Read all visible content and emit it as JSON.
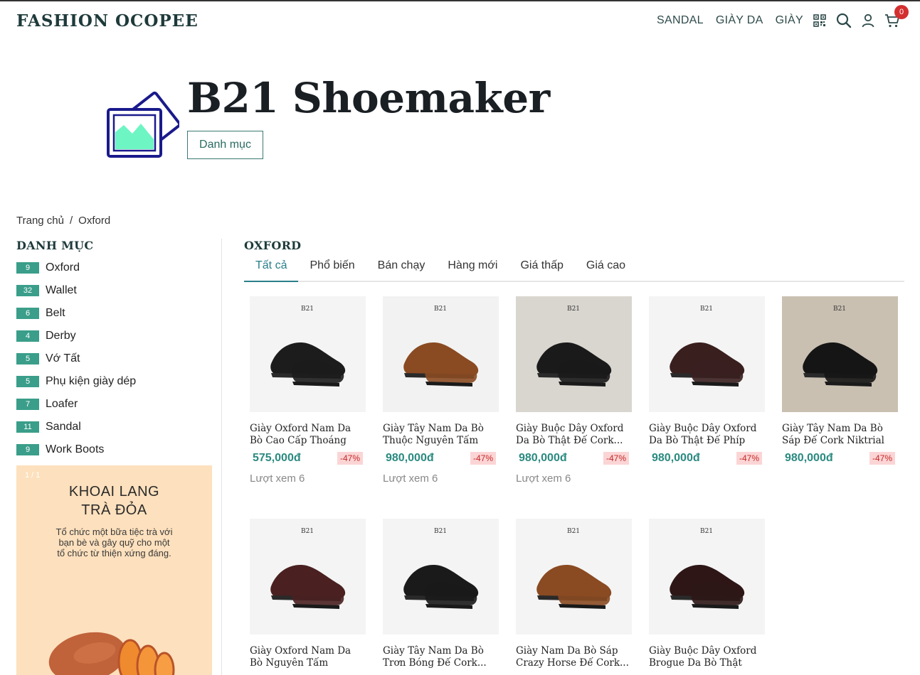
{
  "header": {
    "brand": "FASHION OCOPEE",
    "nav": [
      "SANDAL",
      "GIÀY DA",
      "GIÀY"
    ],
    "cart_count": "0"
  },
  "hero": {
    "title": "B21 Shoemaker",
    "button": "Danh mục"
  },
  "breadcrumb": {
    "home": "Trang chủ",
    "separator": "/",
    "current": "Oxford"
  },
  "sidebar": {
    "title": "DANH MỤC",
    "categories": [
      {
        "count": "9",
        "label": "Oxford"
      },
      {
        "count": "32",
        "label": "Wallet"
      },
      {
        "count": "6",
        "label": "Belt"
      },
      {
        "count": "4",
        "label": "Derby"
      },
      {
        "count": "5",
        "label": "Vớ Tất"
      },
      {
        "count": "5",
        "label": "Phụ kiện giày dép"
      },
      {
        "count": "7",
        "label": "Loafer"
      },
      {
        "count": "11",
        "label": "Sandal"
      },
      {
        "count": "9",
        "label": "Work Boots"
      }
    ],
    "promo": {
      "counter": "1 / 1",
      "title_line1": "KHOAI LANG",
      "title_line2": "TRÀ ĐỎA",
      "desc_line1": "Tổ chức một bữa tiệc trà với",
      "desc_line2": "bạn bè và gây quỹ cho một",
      "desc_line3": "tổ chức từ thiện xứng đáng."
    }
  },
  "main": {
    "title": "OXFORD",
    "tabs": [
      "Tất cả",
      "Phổ biến",
      "Bán chạy",
      "Hàng mới",
      "Giá thấp",
      "Giá cao"
    ],
    "products": [
      {
        "name": "Giày Oxford Nam Da Bò Cao Cấp Thoáng Khí...",
        "price": "575,000đ",
        "discount": "-47%",
        "views": "Lượt xem 6",
        "shoe_color": "#1c1c1c",
        "bg": "#f4f4f4"
      },
      {
        "name": "Giày Tây Nam Da Bò Thuộc Nguyên Tấm Đế...",
        "price": "980,000đ",
        "discount": "-47%",
        "views": "Lượt xem 6",
        "shoe_color": "#8a4a22",
        "bg": "#f2f2f2"
      },
      {
        "name": "Giày Buộc Dây Oxford Da Bò Thật Đế Cork...",
        "price": "980,000đ",
        "discount": "-47%",
        "views": "Lượt xem 6",
        "shoe_color": "#1a1a1a",
        "bg": "#d9d6d0"
      },
      {
        "name": "Giày Buộc Dây Oxford Da Bò Thật Đế Phíp Gỗ...",
        "price": "980,000đ",
        "discount": "-47%",
        "views": "",
        "shoe_color": "#3a1f1f",
        "bg": "#f4f4f4"
      },
      {
        "name": "Giày Tây Nam Da Bò Sáp Đế Cork Niktrial L...",
        "price": "980,000đ",
        "discount": "-47%",
        "views": "",
        "shoe_color": "#151515",
        "bg": "#c9c0b2"
      },
      {
        "name": "Giày Oxford Nam Da Bò Nguyên Tấm Chống...",
        "price": "",
        "discount": "",
        "views": "",
        "shoe_color": "#4a2020",
        "bg": "#f4f4f4"
      },
      {
        "name": "Giày Tây Nam Da Bò Trơn Bóng Đế Cork...",
        "price": "",
        "discount": "",
        "views": "",
        "shoe_color": "#1a1a1a",
        "bg": "#f4f4f4"
      },
      {
        "name": "Giày Nam Da Bò Sáp Crazy Horse Đế Cork...",
        "price": "",
        "discount": "",
        "views": "",
        "shoe_color": "#8a4a22",
        "bg": "#f4f4f4"
      },
      {
        "name": "Giày Buộc Dây Oxford Brogue Da Bò Thật Đế...",
        "price": "",
        "discount": "",
        "views": "",
        "shoe_color": "#2e1616",
        "bg": "#f4f4f4"
      }
    ]
  },
  "icons": [
    "qr-code-icon",
    "search-icon",
    "user-icon",
    "cart-icon",
    "image-placeholder-icon"
  ],
  "colors": {
    "accent": "#2a7f8a",
    "badge": "#3a9e8a",
    "price": "#2a8a80",
    "discount_bg": "#fbd5d5",
    "discount_text": "#c62828",
    "cart_badge": "#d32f2f"
  }
}
